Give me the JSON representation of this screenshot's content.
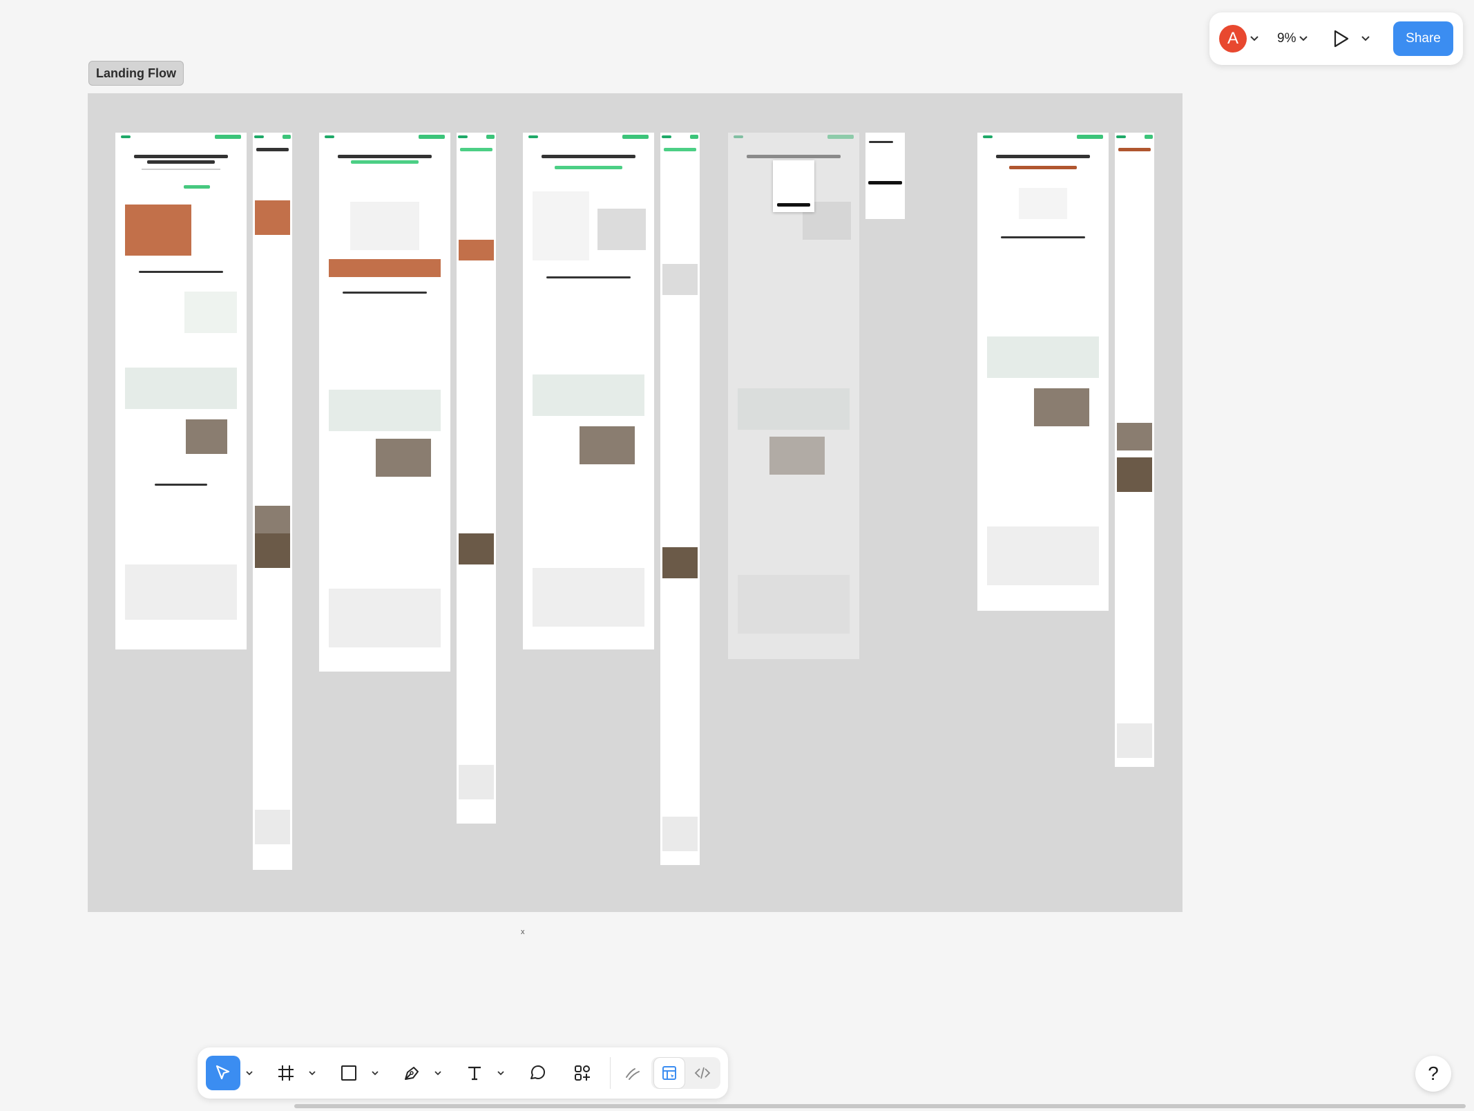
{
  "toolbar": {
    "avatar_initial": "A",
    "zoom_level": "9%",
    "share_label": "Share",
    "accent_color": "#3b8df1"
  },
  "canvas": {
    "section_label": "Landing Flow",
    "stray_mark": "x"
  },
  "bottom_toolbar": {
    "tools": [
      "move",
      "frame",
      "rectangle",
      "pen",
      "text",
      "comment",
      "actions",
      "draw",
      "dev-mode-design",
      "dev-mode-code"
    ],
    "active_tool": "move"
  },
  "help": {
    "label": "?"
  }
}
